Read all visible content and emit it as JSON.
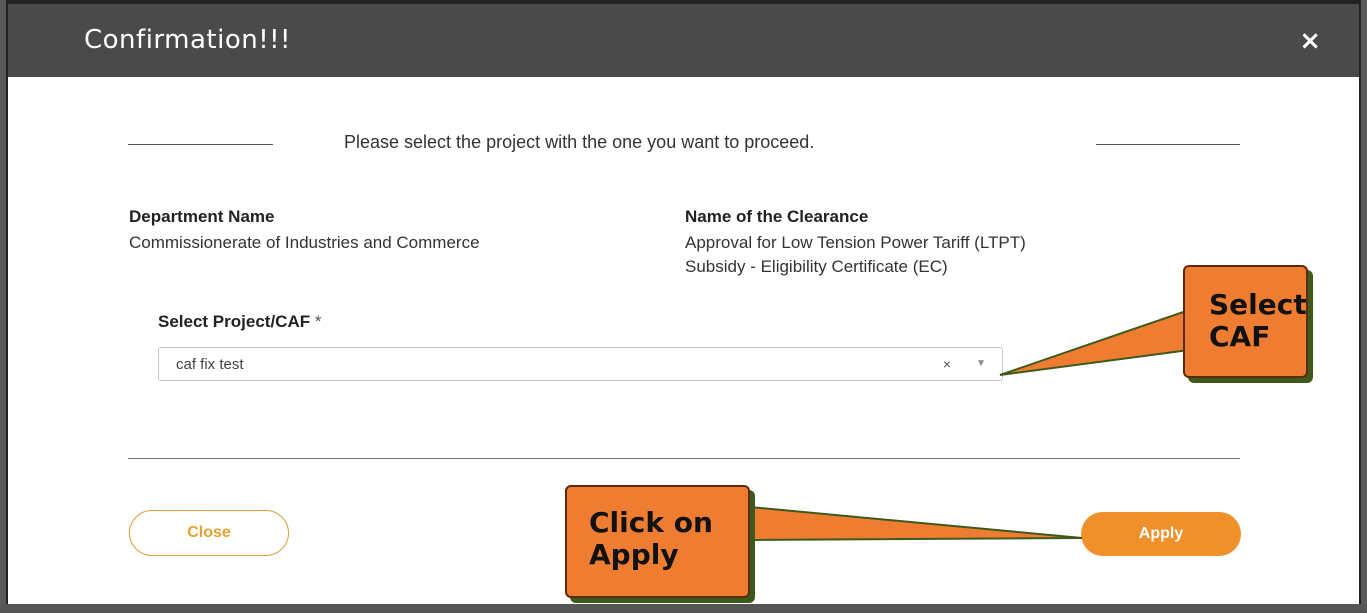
{
  "modal": {
    "title": "Confirmation!!!",
    "close_symbol": "×"
  },
  "instruction": "Please select the project with the one you want to proceed.",
  "department": {
    "label": "Department Name",
    "value": "Commissionerate of Industries and Commerce"
  },
  "clearance": {
    "label": "Name of the Clearance",
    "value_line1": "Approval for Low Tension Power Tariff (LTPT)",
    "value_line2": "Subsidy - Eligibility Certificate (EC)"
  },
  "project_select": {
    "label": "Select Project/CAF",
    "required_mark": "*",
    "selected_value": "caf fix test",
    "clear_symbol": "×",
    "arrow_symbol": "▼"
  },
  "buttons": {
    "close_label": "Close",
    "apply_label": "Apply"
  },
  "callouts": {
    "select_caf_line1": "Select",
    "select_caf_line2": "CAF",
    "apply_line1": "Click on",
    "apply_line2": "Apply"
  },
  "colors": {
    "header_bg": "#4a4a4a",
    "accent_orange": "#f0902a",
    "callout_orange": "#ef7d31",
    "callout_shadow": "#3e5a1a"
  }
}
